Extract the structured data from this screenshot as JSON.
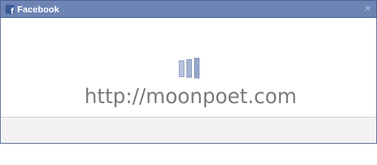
{
  "dialog": {
    "title": "Facebook",
    "logo_letter": "f",
    "close_symbol": "×",
    "logo_icon": "facebook-logo-icon",
    "close_icon": "close-icon"
  },
  "content": {
    "loading_icon": "loading-spinner-icon",
    "watermark": "http://moonpoet.com"
  },
  "colors": {
    "titlebar": "#6d84b4",
    "titlebar_border": "#3b5998",
    "footer": "#f2f2f2"
  }
}
